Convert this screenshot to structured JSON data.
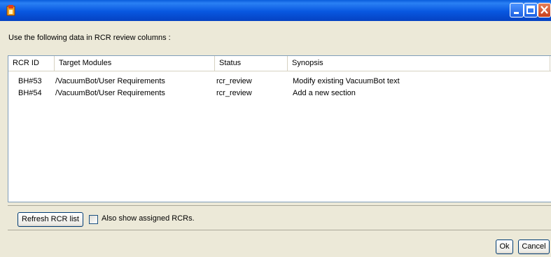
{
  "window": {
    "title": ""
  },
  "instruction": "Use the following data in RCR review columns :",
  "table": {
    "columns": [
      "RCR ID",
      "Target Modules",
      "Status",
      "Synopsis"
    ],
    "rows": [
      [
        "BH#53",
        "/VacuumBot/User Requirements",
        "rcr_review",
        "Modify existing VacuumBot text"
      ],
      [
        "BH#54",
        "/VacuumBot/User Requirements",
        "rcr_review",
        "Add a new section"
      ]
    ]
  },
  "buttons": {
    "refresh": "Refresh RCR list",
    "ok": "Ok",
    "cancel": "Cancel"
  },
  "checkbox": {
    "label": "Also show assigned RCRs.",
    "checked": false
  },
  "colors": {
    "titlebar": "#0a5ddb",
    "dialog_bg": "#ece9d8"
  }
}
